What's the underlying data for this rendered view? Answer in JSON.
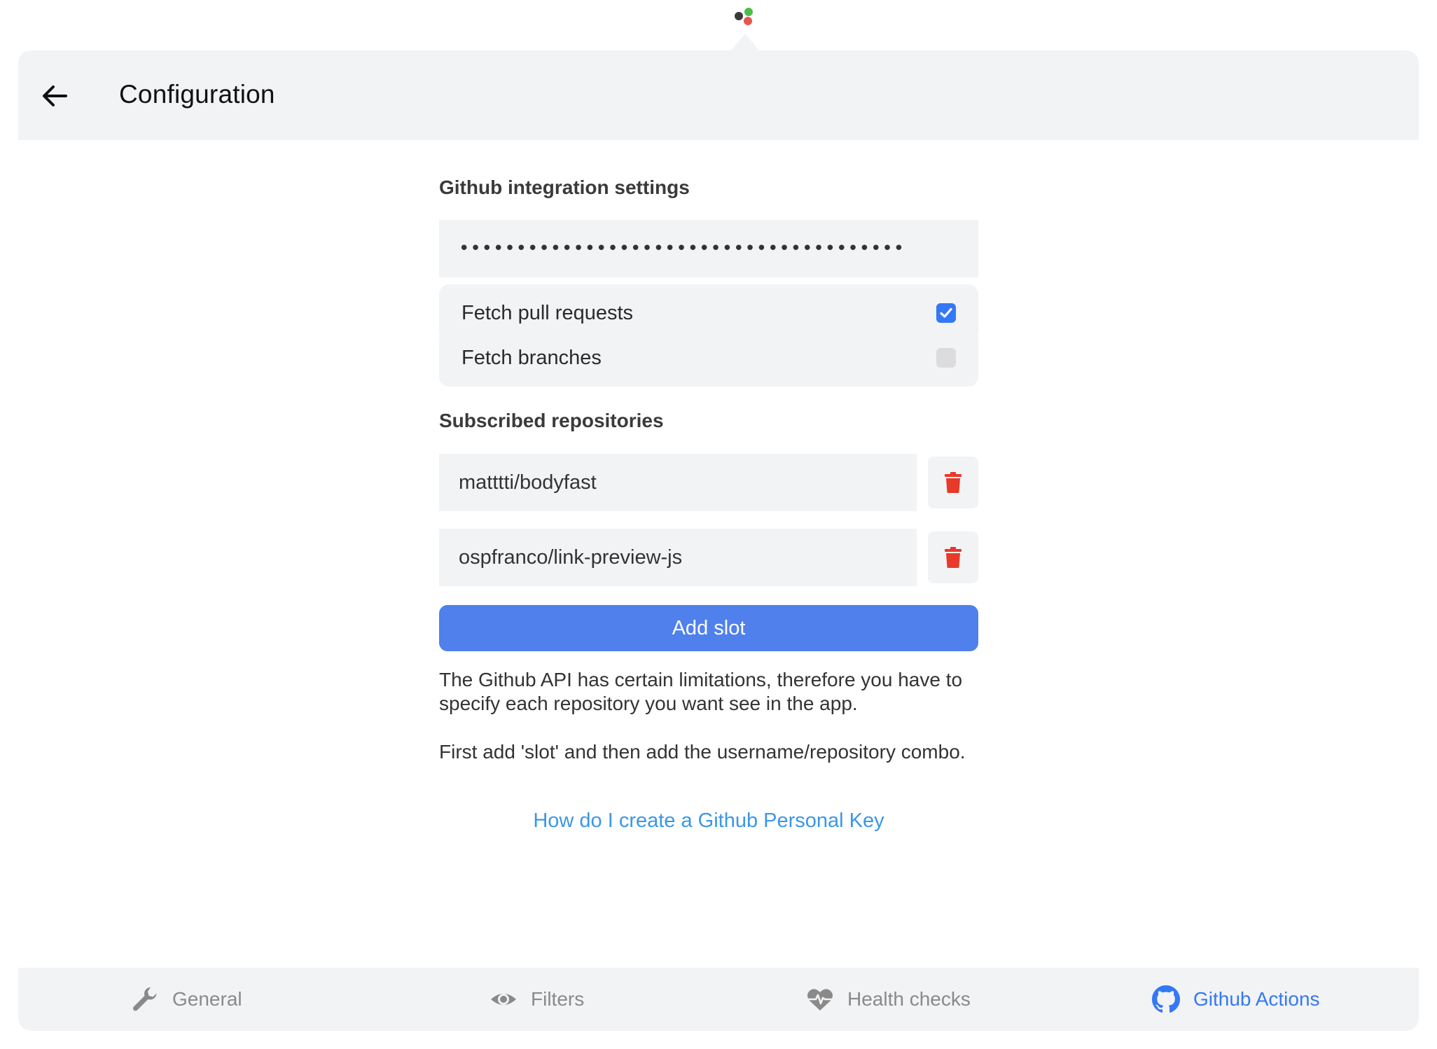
{
  "header": {
    "title": "Configuration"
  },
  "github": {
    "section_title": "Github integration settings",
    "token_value": "•••••••••••••••••••••••••••••••••••••••",
    "options": [
      {
        "label": "Fetch pull requests",
        "checked": true
      },
      {
        "label": "Fetch branches",
        "checked": false
      }
    ]
  },
  "repos": {
    "section_title": "Subscribed repositories",
    "items": [
      {
        "name": "matttti/bodyfast"
      },
      {
        "name": "ospfranco/link-preview-js"
      }
    ],
    "add_label": "Add slot"
  },
  "info": {
    "paragraph1": "The Github API has certain limitations, therefore you have to specify each repository you want see in the app.",
    "paragraph2": "First add 'slot' and then add the username/repository combo.",
    "link_text": "How do I create a Github Personal Key"
  },
  "tabs": [
    {
      "label": "General",
      "icon": "wrench-icon",
      "active": false
    },
    {
      "label": "Filters",
      "icon": "eye-icon",
      "active": false
    },
    {
      "label": "Health checks",
      "icon": "heartbeat-icon",
      "active": false
    },
    {
      "label": "Github Actions",
      "icon": "github-icon",
      "active": true
    }
  ],
  "colors": {
    "accent": "#3478f6",
    "button": "#4f80ec",
    "delete": "#e8392b",
    "link": "#3b97e6",
    "panel": "#f2f3f5"
  }
}
